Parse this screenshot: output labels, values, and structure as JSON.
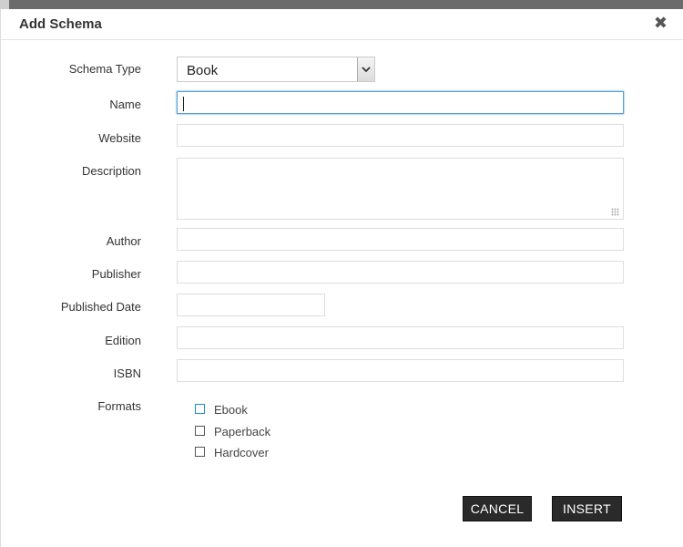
{
  "dialog": {
    "title": "Add Schema",
    "close_symbol": "✖"
  },
  "form": {
    "schema_type": {
      "label": "Schema Type",
      "selected": "Book"
    },
    "name": {
      "label": "Name",
      "value": ""
    },
    "website": {
      "label": "Website",
      "value": ""
    },
    "description": {
      "label": "Description",
      "value": ""
    },
    "author": {
      "label": "Author",
      "value": ""
    },
    "publisher": {
      "label": "Publisher",
      "value": ""
    },
    "published_date": {
      "label": "Published Date",
      "value": ""
    },
    "edition": {
      "label": "Edition",
      "value": ""
    },
    "isbn": {
      "label": "ISBN",
      "value": ""
    },
    "formats": {
      "label": "Formats",
      "options": [
        {
          "label": "Ebook",
          "checked": false
        },
        {
          "label": "Paperback",
          "checked": false
        },
        {
          "label": "Hardcover",
          "checked": false
        }
      ]
    }
  },
  "actions": {
    "cancel_label": "CANCEL",
    "insert_label": "INSERT"
  },
  "colors": {
    "button_bg": "#2a2a2a",
    "focus_border": "#5b9dd9"
  }
}
